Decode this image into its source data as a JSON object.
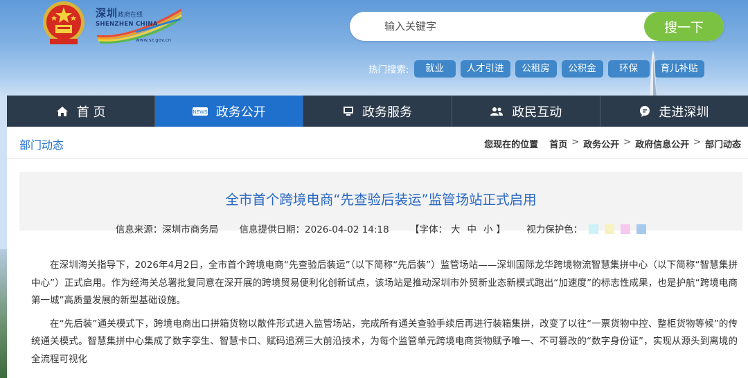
{
  "header": {
    "logo": {
      "brand_cn": "深圳",
      "brand_cn_small": "政府在线",
      "brand_en": "SHENZHEN CHINA",
      "url": "www.sz.gov.cn"
    },
    "search": {
      "placeholder": "输入关键字",
      "button_label": "搜一下"
    },
    "hot": {
      "label": "热门搜索:",
      "tags": [
        "就业",
        "人才引进",
        "公租房",
        "公积金",
        "环保",
        "育儿补贴"
      ]
    }
  },
  "nav": {
    "items": [
      {
        "label": "首 页",
        "icon": "home-icon"
      },
      {
        "label": "政务公开",
        "icon": "news-icon"
      },
      {
        "label": "政务服务",
        "icon": "monitor-icon"
      },
      {
        "label": "政民互动",
        "icon": "users-icon"
      },
      {
        "label": "走进深圳",
        "icon": "chat-bubble-icon"
      }
    ],
    "active_index": 1
  },
  "breadcrumb": {
    "section_title": "部门动态",
    "location_label": "您现在的位置",
    "items": [
      "首页",
      "政务公开",
      "政府信息公开",
      "部门动态"
    ],
    "separator": ">"
  },
  "article": {
    "title": "全市首个跨境电商“先查验后装运”监管场站正式启用",
    "source": "信息来源：深圳市商务局",
    "date": "信息提供日期：2026-04-02 14:18",
    "font_label_open": "【字体：",
    "font_sizes": [
      "大",
      "中",
      "小"
    ],
    "font_label_close": "】",
    "eye_care_label": "视力保护色：",
    "eye_care_colors": [
      "#ccf1f7",
      "#f7f2c0",
      "#f7c8ee",
      "#a8c9ee"
    ],
    "paragraphs": [
      "在深圳海关指导下，2026年4月2日，全市首个跨境电商“先查验后装运”（以下简称“先后装”）监管场站——深圳国际龙华跨境物流智慧集拼中心（以下简称“智慧集拼中心”）正式启用。作为经海关总署批复同意在深开展的跨境贸易便利化创新试点，该场站是推动深圳市外贸新业态新模式跑出“加速度”的标志性成果，也是护航“跨境电商第一城”高质量发展的新型基础设施。",
      "在“先后装”通关模式下，跨境电商出口拼箱货物以散件形式进入监管场站，完成所有通关查验手续后再进行装箱集拼，改变了以往“一票货物中控、整柜货物等候”的传统通关模式。智慧集拼中心集成了数字孪生、智慧卡口、赋码追溯三大前沿技术，为每个监管单元跨境电商货物赋予唯一、不可篡改的“数字身份证”，实现从源头到离境的全流程可视化"
    ]
  },
  "colors": {
    "nav_bg": "#2c3b4c",
    "nav_active": "#1f6fcd",
    "search_button": "#7cc242",
    "hot_tag": "#3f87c9",
    "title_blue": "#2a68c4"
  }
}
